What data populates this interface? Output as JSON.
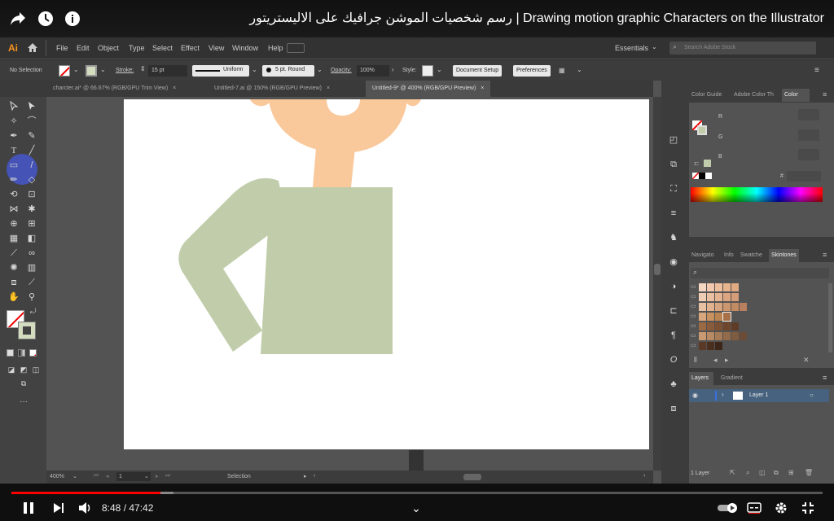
{
  "video": {
    "title": "رسم شخصيات الموشن جرافيك على الاليستريتور | Drawing motion graphic Characters on the Illustrator",
    "time_current": "8:48",
    "time_separator": " / ",
    "time_total": "47:42",
    "progress": 0.184,
    "buffered": 0.2
  },
  "app": {
    "logo": "Ai",
    "menu": [
      "File",
      "Edit",
      "Object",
      "Type",
      "Select",
      "Effect",
      "View",
      "Window",
      "Help"
    ],
    "workspace": "Essentials",
    "search_placeholder": "Search Adobe Stock"
  },
  "control_bar": {
    "selection": "No Selection",
    "stroke_label": "Stroke:",
    "stroke_value": "15 pt",
    "profile": "Uniform",
    "brush": "5 pt. Round",
    "opacity_label": "Opacity:",
    "opacity_value": "100%",
    "style_label": "Style:",
    "document_setup": "Document Setup",
    "preferences": "Preferences"
  },
  "tabs": [
    {
      "label": "charcter.ai* @ 66.67% (RGB/GPU Trim View)"
    },
    {
      "label": "Untitled-7.ai @ 150% (RGB/GPU Preview)"
    },
    {
      "label": "Untitled-9* @ 400% (RGB/GPU Preview)"
    }
  ],
  "status": {
    "zoom": "400%",
    "artboard": "1",
    "mode": "Selection"
  },
  "color_panel": {
    "tabs": [
      "Color Guide",
      "Adobe Color Th",
      "Color"
    ],
    "channels": [
      "R",
      "G",
      "B"
    ],
    "hex_symbol": "#"
  },
  "swatch_panel": {
    "tabs": [
      "Navigato",
      "Info",
      "Swatche",
      "Skintones"
    ]
  },
  "layers_panel": {
    "tabs": [
      "Layers",
      "Gradient"
    ],
    "layer_name": "Layer 1",
    "count": "1 Layer"
  },
  "colors": {
    "skin": "#f9c89b",
    "shirt": "#c1cdaa",
    "fill_swatch": "#d4dcc0"
  }
}
